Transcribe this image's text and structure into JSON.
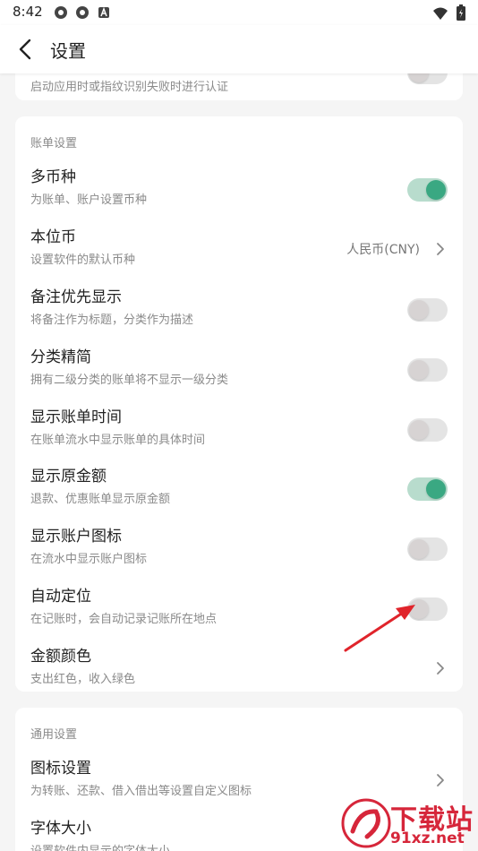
{
  "status_bar": {
    "time": "8:42",
    "left_icons": [
      "gear-icon",
      "gear-icon",
      "a-badge-icon"
    ],
    "right_icons": [
      "wifi-icon",
      "battery-icon"
    ]
  },
  "app_bar": {
    "title": "设置"
  },
  "top_card": {
    "subtitle": "启动应用时或指纹识别失败时进行认证",
    "toggle_on": false
  },
  "bill_section": {
    "title": "账单设置",
    "rows": [
      {
        "title": "多币种",
        "subtitle": "为账单、账户设置币种",
        "control": "toggle",
        "on": true
      },
      {
        "title": "本位币",
        "subtitle": "设置软件的默认币种",
        "control": "chevron",
        "value": "人民币(CNY)"
      },
      {
        "title": "备注优先显示",
        "subtitle": "将备注作为标题，分类作为描述",
        "control": "toggle",
        "on": false
      },
      {
        "title": "分类精简",
        "subtitle": "拥有二级分类的账单将不显示一级分类",
        "control": "toggle",
        "on": false
      },
      {
        "title": "显示账单时间",
        "subtitle": "在账单流水中显示账单的具体时间",
        "control": "toggle",
        "on": false
      },
      {
        "title": "显示原金额",
        "subtitle": "退款、优惠账单显示原金额",
        "control": "toggle",
        "on": true
      },
      {
        "title": "显示账户图标",
        "subtitle": "在流水中显示账户图标",
        "control": "toggle",
        "on": false
      },
      {
        "title": "自动定位",
        "subtitle": "在记账时，会自动记录记账所在地点",
        "control": "toggle",
        "on": false
      },
      {
        "title": "金额颜色",
        "subtitle": "支出红色，收入绿色",
        "control": "chevron",
        "value": ""
      }
    ]
  },
  "general_section": {
    "title": "通用设置",
    "rows": [
      {
        "title": "图标设置",
        "subtitle": "为转账、还款、借入借出等设置自定义图标",
        "control": "chevron"
      },
      {
        "title": "字体大小",
        "subtitle": "设置软件内显示的字体大小",
        "control": "none"
      }
    ]
  },
  "colors": {
    "accent_green": "#3aa882",
    "annotation_arrow": "#e0242b",
    "watermark_red": "#d6263a"
  },
  "watermark": {
    "main": "下载站",
    "url": "91xz.net"
  }
}
